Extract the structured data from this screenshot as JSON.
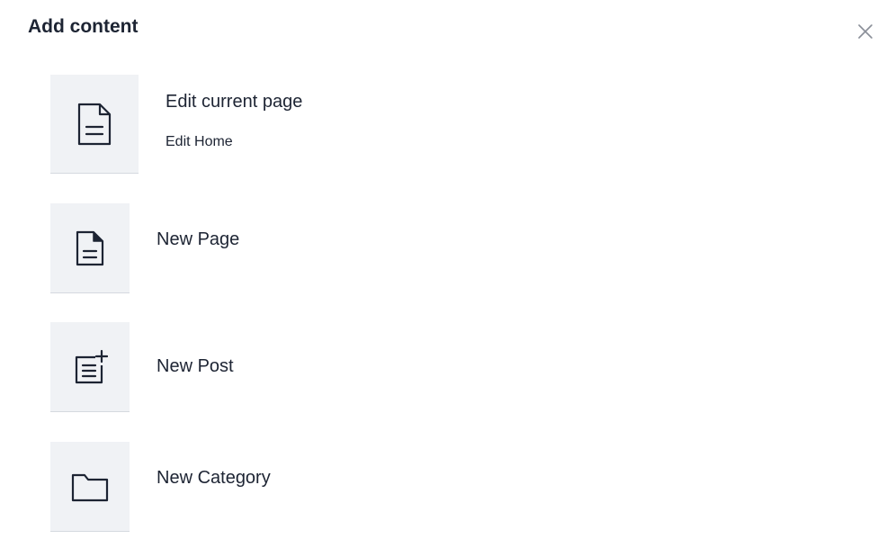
{
  "dialog": {
    "title": "Add content",
    "close_icon": "close-icon"
  },
  "items": [
    {
      "label": "Edit current page",
      "sublabel": "Edit Home",
      "icon": "document-icon"
    },
    {
      "label": "New Page",
      "icon": "page-icon"
    },
    {
      "label": "New Post",
      "icon": "post-add-icon"
    },
    {
      "label": "New Category",
      "icon": "folder-icon"
    }
  ],
  "colors": {
    "text": "#1d2433",
    "tile_bg": "#f0f2f5",
    "tile_border": "#d5d9df",
    "close": "#8a8f98"
  }
}
